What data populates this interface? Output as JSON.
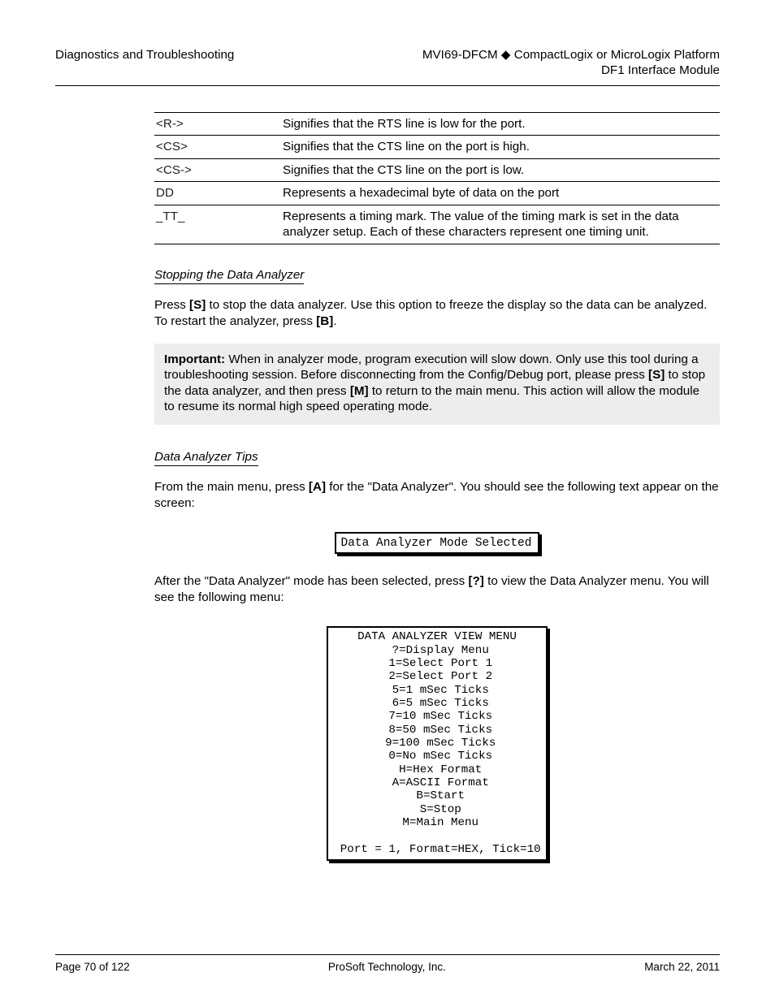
{
  "header": {
    "left": "Diagnostics and Troubleshooting",
    "right_line1_a": "MVI69-DFCM ",
    "right_line1_b": " CompactLogix or MicroLogix Platform",
    "right_line2": "DF1 Interface Module"
  },
  "table": {
    "rows": [
      {
        "l": "<R->",
        "r": "Signifies that the RTS line is low for the port."
      },
      {
        "l": "<CS>",
        "r": "Signifies that the CTS line on the port is high."
      },
      {
        "l": "<CS->",
        "r": "Signifies that the CTS line on the port is low."
      },
      {
        "l": "DD",
        "r": "Represents a hexadecimal byte of data on the port"
      },
      {
        "l": "_TT_",
        "r": "Represents a timing mark. The value of the timing mark is set in the data analyzer setup. Each of these characters represent one timing unit."
      }
    ]
  },
  "sec1": {
    "title": "Stopping the Data Analyzer",
    "para_a": "Press ",
    "key": "[S]",
    "para_b": " to stop the data analyzer. Use this option to freeze the display so the data can be analyzed. To restart the analyzer, press ",
    "key2": "[B]",
    "para_c": "."
  },
  "important": {
    "label": "Important:",
    "body_a": " When in analyzer mode, program execution will slow down. Only use this tool during a troubleshooting session. Before disconnecting from the Config/Debug port, please press ",
    "key1": "[S]",
    "body_b": " to stop the data analyzer, and then press ",
    "key2": "[M]",
    "body_c": " to return to the main menu. This action will allow the module to resume its normal high speed operating mode."
  },
  "sec2": {
    "title": "Data Analyzer Tips",
    "para1": "From the main menu, press ",
    "key1": "[A]",
    "para1b": " for the \"Data Analyzer\". You should see the following text appear on the screen:",
    "fig1": "Data Analyzer Mode Selected",
    "para2": "After the \"Data Analyzer\" mode has been selected, press ",
    "key2": "[?]",
    "para2b": " to view the Data Analyzer menu. You will see the following menu:",
    "fig2": "DATA ANALYZER VIEW MENU\n ?=Display Menu\n 1=Select Port 1\n 2=Select Port 2\n 5=1 mSec Ticks\n 6=5 mSec Ticks\n 7=10 mSec Ticks\n 8=50 mSec Ticks\n 9=100 mSec Ticks\n 0=No mSec Ticks\n H=Hex Format\n A=ASCII Format\n B=Start\n S=Stop\n M=Main Menu\n\n Port = 1, Format=HEX, Tick=10"
  },
  "footer": {
    "left": "Page 70 of 122",
    "center": "ProSoft Technology, Inc.",
    "right": "March 22, 2011"
  }
}
